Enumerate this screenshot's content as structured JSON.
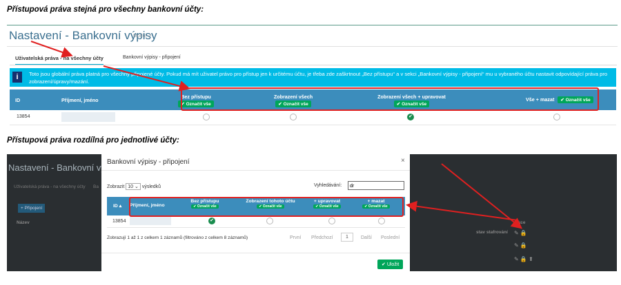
{
  "top": {
    "heading": "Přístupová práva stejná pro všechny bankovní účty:",
    "app_title": "Nastavení - Bankovní výpisy",
    "modul_link": "Modul",
    "tabs": [
      "Uživatelská práva - na všechny účty",
      "Bankovní výpisy - připojení"
    ],
    "info_text": "Toto jsou globální práva platná pro všechny připojené účty. Pokud má mít uživatel právo pro přístup jen k určitému účtu, je třeba zde zaškrtnout „Bez přístupu“ a v sekci „Bankovní výpisy - připojení“ mu u vybraného účtu nastavit odpovídající práva pro zobrazení/úpravy/mazání.",
    "columns": [
      "ID",
      "Příjmení, jméno",
      "Bez přístupu",
      "Zobrazení všech",
      "Zobrazení všech + upravovat",
      "Vše + mazat"
    ],
    "mark_all_label": "Označit vše",
    "row": {
      "id": "13854",
      "selected": "Zobrazení všech + upravovat"
    }
  },
  "bottom": {
    "heading": "Přístupová práva rozdílná pro jednotlivé účty:",
    "bg_title": "Nastavení - Bankovní výp",
    "bg_tab1": "Uživatelská práva - na všechny účty",
    "bg_tab2": "Ba",
    "bg_add_button": "+ Připojení",
    "bg_col_nazev": "Název",
    "bg_col_stav": "stav stafrování",
    "bg_col_akce": "Akce",
    "modal": {
      "title": "Bankovní výpisy - připojení",
      "show_label": "Zobrazit",
      "show_value": "10",
      "show_suffix": "výsledků",
      "search_label": "Vyhledávání:",
      "search_value": "dr",
      "columns": [
        "ID",
        "Příjmení, jméno",
        "Bez přístupu",
        "Zobrazení tohoto účtu",
        "+ upravovat",
        "+ mazat"
      ],
      "mark_all_label": "Označit vše",
      "row_id": "13854",
      "info": "Zobrazují 1 až 1 z celkem 1 záznamů (filtrováno z celkem 8 záznamů)",
      "pager": [
        "První",
        "Předchozí",
        "1",
        "Další",
        "Poslední"
      ],
      "save": "Uložit"
    }
  },
  "colors": {
    "accent": "#3c8dbc",
    "info": "#00bbe6",
    "green": "#00a65a",
    "highlight": "#e02020"
  }
}
